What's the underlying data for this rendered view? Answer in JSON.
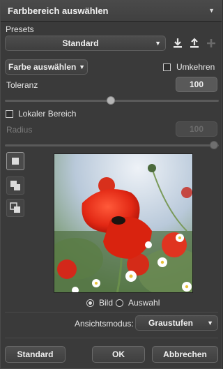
{
  "window": {
    "title": "Farbbereich auswählen",
    "menu_icon": "triangle-down-icon"
  },
  "presets": {
    "label": "Presets",
    "value": "Standard",
    "icons": [
      "download-icon",
      "upload-icon",
      "plus-icon"
    ]
  },
  "select": {
    "value": "Farbe auswählen"
  },
  "invert": {
    "label": "Umkehren",
    "checked": false
  },
  "tolerance": {
    "label": "Toleranz",
    "value": "100",
    "slider_fraction": 0.5
  },
  "local": {
    "label": "Lokaler Bereich",
    "checked": false
  },
  "radius": {
    "label": "Radius",
    "value": "100",
    "slider_fraction": 1.0
  },
  "preview_mode": {
    "options": [
      "Bild",
      "Auswahl"
    ],
    "selected": "Bild"
  },
  "view": {
    "label": "Ansichtsmodus:",
    "value": "Graustufen"
  },
  "buttons": {
    "standard": "Standard",
    "ok": "OK",
    "cancel": "Abbrechen"
  },
  "colors": {
    "panel": "#3a3a3a",
    "accent": "#d62b1a"
  }
}
